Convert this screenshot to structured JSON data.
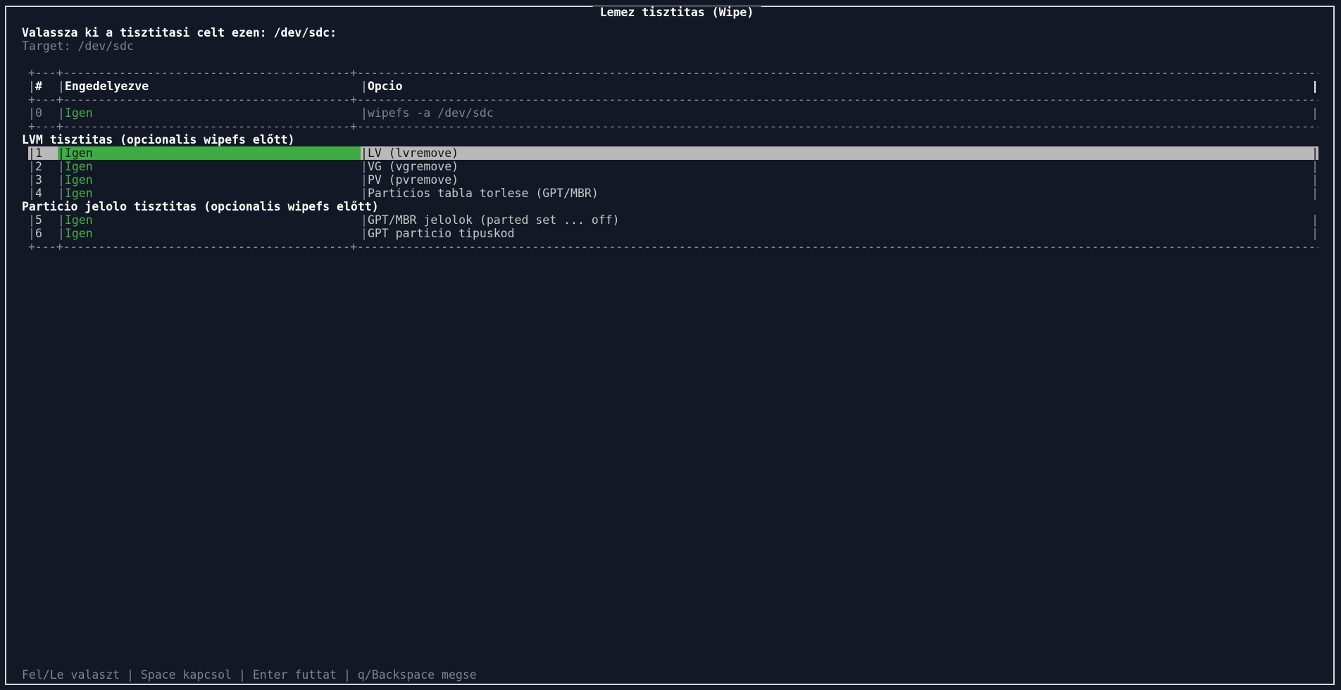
{
  "window": {
    "title": "Lemez tisztitas (Wipe)"
  },
  "prompt": {
    "heading": "Valassza ki a tisztitasi celt ezen: /dev/sdc:",
    "target": "Target: /dev/sdc"
  },
  "table": {
    "headers": {
      "num": "#",
      "enabled": "Engedelyezve",
      "option": "Opcio"
    },
    "sep_top": "+---+-----------------------------------------+-------------------------------------------------------------------------------------------------------------------------------------------------------------------------+",
    "base_row": {
      "num": "0",
      "enabled": "Igen",
      "option": "wipefs -a /dev/sdc"
    },
    "sections": [
      {
        "title": "LVM tisztitas (opcionalis wipefs előtt)",
        "rows": [
          {
            "num": "1",
            "enabled": "Igen",
            "option": "LV (lvremove)",
            "selected": true
          },
          {
            "num": "2",
            "enabled": "Igen",
            "option": "VG (vgremove)"
          },
          {
            "num": "3",
            "enabled": "Igen",
            "option": "PV (pvremove)"
          },
          {
            "num": "4",
            "enabled": "Igen",
            "option": "Particios tabla torlese (GPT/MBR)"
          }
        ]
      },
      {
        "title": "Particio jelolo tisztitas (opcionalis wipefs előtt)",
        "rows": [
          {
            "num": "5",
            "enabled": "Igen",
            "option": "GPT/MBR jelolok (parted set ... off)"
          },
          {
            "num": "6",
            "enabled": "Igen",
            "option": "GPT particio tipuskod"
          }
        ]
      }
    ]
  },
  "footer": {
    "help": "Fel/Le valaszt | Space kapcsol | Enter futtat | q/Backspace megse"
  },
  "colors": {
    "background": "#121826",
    "enabled": "#48b04a",
    "selected_row": "#b9b9b9",
    "selected_cell": "#40ab44"
  }
}
